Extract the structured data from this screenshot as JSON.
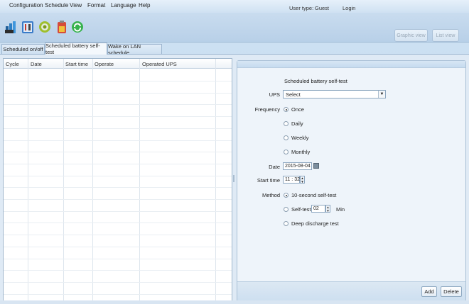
{
  "menu": {
    "items": [
      "Configuration",
      "Schedule",
      "View",
      "Format",
      "Language",
      "Help"
    ]
  },
  "user": {
    "type_label": "User type:",
    "type_value": "Guest",
    "login_label": "Login"
  },
  "toolbar": {
    "icons": [
      "chart-icon",
      "settings-tools-icon",
      "gear-icon",
      "battery-icon",
      "refresh-icon"
    ],
    "graphic_view_label": "Graphic view",
    "list_view_label": "List view"
  },
  "tabs": [
    {
      "label": "Scheduled on/off",
      "active": false
    },
    {
      "label": "Scheduled battery self-test",
      "active": true
    },
    {
      "label": "Wake on LAN schedule",
      "active": false
    }
  ],
  "table": {
    "columns": [
      "Cycle",
      "Date",
      "Start time",
      "Operate",
      "Operated UPS"
    ],
    "rows": []
  },
  "form": {
    "title": "Scheduled battery self-test",
    "ups_label": "UPS",
    "ups_value": "Select",
    "frequency_label": "Frequency",
    "frequency_options": [
      "Once",
      "Daily",
      "Weekly",
      "Monthly"
    ],
    "frequency_selected": "Once",
    "date_label": "Date",
    "date_value": "2015-08-04",
    "start_time_label": "Start time",
    "start_time_hour": "11",
    "start_time_minute": "32",
    "method_label": "Method",
    "method_options": [
      "10-second self-test",
      "Self-test",
      "Deep discharge test"
    ],
    "method_selected": "10-second self-test",
    "selftest_minutes": "02",
    "selftest_unit": "Min",
    "add_label": "Add",
    "delete_label": "Delete"
  },
  "colors": {
    "background": "#cfe2f3",
    "panel": "#eef4fa",
    "border": "#9fb6cc"
  }
}
